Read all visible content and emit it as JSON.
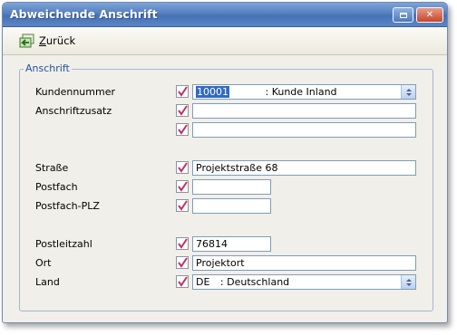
{
  "window": {
    "title": "Abweichende Anschrift"
  },
  "toolbar": {
    "back_label_first": "Z",
    "back_label_rest": "urück"
  },
  "group": {
    "legend": "Anschrift"
  },
  "fields": {
    "kundennummer": {
      "label": "Kundennummer",
      "code": "10001",
      "text": ": Kunde Inland"
    },
    "anschriftzusatz": {
      "label": "Anschriftzusatz",
      "value1": "",
      "value2": ""
    },
    "strasse": {
      "label": "Straße",
      "value": "Projektstraße 68"
    },
    "postfach": {
      "label": "Postfach",
      "value": ""
    },
    "postfach_plz": {
      "label": "Postfach-PLZ",
      "value": ""
    },
    "postleitzahl": {
      "label": "Postleitzahl",
      "value": "76814"
    },
    "ort": {
      "label": "Ort",
      "value": "Projektort"
    },
    "land": {
      "label": "Land",
      "code": "DE",
      "text": ": Deutschland"
    }
  },
  "icons": {
    "back": "arrow-back-icon",
    "checkbox_mark": "check-icon",
    "spin": "spin-updown-icon"
  },
  "colors": {
    "title_bar": "#5580c0",
    "legend": "#2352a0",
    "selection": "#316ac5",
    "check": "#c0306a"
  }
}
